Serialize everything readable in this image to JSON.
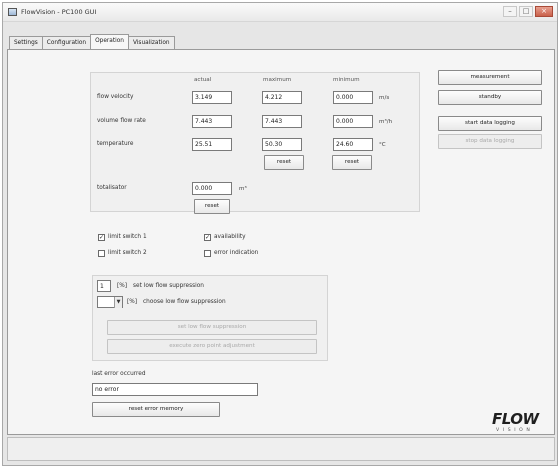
{
  "window": {
    "title": "FlowVision - PC100 GUI",
    "title_right": "FLOWVISION"
  },
  "tabs": [
    {
      "label": "Settings"
    },
    {
      "label": "Configuration"
    },
    {
      "label": "Operation"
    },
    {
      "label": "Visualization"
    }
  ],
  "measurements": {
    "headers": {
      "actual": "actual",
      "maximum": "maximum",
      "minimum": "minimum"
    },
    "rows": [
      {
        "label": "flow velocity",
        "actual": "3.149",
        "maximum": "4.212",
        "minimum": "0.000",
        "unit": "m/s"
      },
      {
        "label": "volume flow rate",
        "actual": "7.443",
        "maximum": "7.443",
        "minimum": "0.000",
        "unit": "m³/h"
      },
      {
        "label": "temperature",
        "actual": "25.51",
        "maximum": "50.30",
        "minimum": "24.60",
        "unit": "°C"
      }
    ],
    "reset_max_label": "reset",
    "reset_min_label": "reset",
    "totalisator_label": "totalisator",
    "totalisator_value": "0.000",
    "totalisator_unit": "m³",
    "reset_total_label": "reset"
  },
  "right_buttons": {
    "measurement": "measurement",
    "standby": "standby",
    "start_logging": "start data logging",
    "stop_logging": "stop data logging"
  },
  "checkboxes": [
    {
      "label": "limit switch 1",
      "checked": true
    },
    {
      "label": "limit switch 2",
      "checked": false
    },
    {
      "label": "availability",
      "checked": true
    },
    {
      "label": "error indication",
      "checked": false
    }
  ],
  "low_flow": {
    "set_value": "1",
    "set_unit": "[%]",
    "set_label": "set low flow suppression",
    "choose_unit": "[%]",
    "choose_label": "choose low flow suppression",
    "set_button": "set low flow suppression",
    "zero_button": "execute zero point adjustment"
  },
  "errors": {
    "label": "last error occurred",
    "value": "no error",
    "reset_button": "reset error memory"
  },
  "logo": {
    "main": "FLOW",
    "sub": "VISION"
  },
  "colors": {
    "check_mark": "#222222",
    "disabled_text": "#a8a8a8"
  }
}
